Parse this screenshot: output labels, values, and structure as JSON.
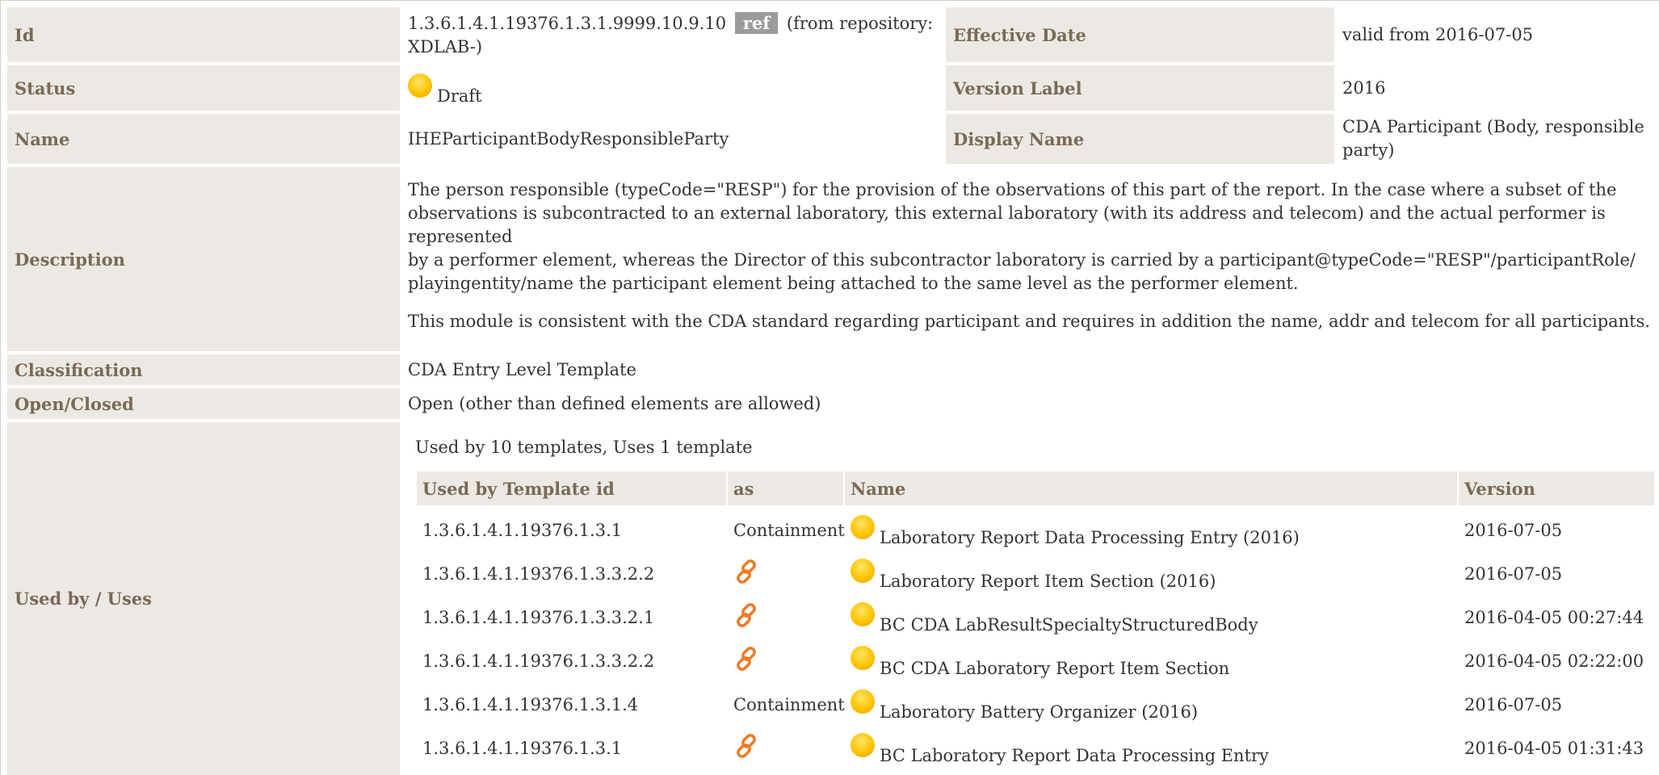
{
  "rows": {
    "id": {
      "label": "Id",
      "value_pre": "1.3.6.1.4.1.19376.1.3.1.9999.10.9.10",
      "ref": "ref",
      "value_post": "(from repository:",
      "value_line2": "XDLAB-)"
    },
    "effective_date": {
      "label": "Effective Date",
      "value": "valid from 2016-07-05"
    },
    "status": {
      "label": "Status",
      "value": "Draft",
      "icon": "status-draft-icon",
      "icon_color": "#ffc400"
    },
    "version_label": {
      "label": "Version Label",
      "value": "2016"
    },
    "name": {
      "label": "Name",
      "value": "IHEParticipantBodyResponsibleParty"
    },
    "display_name": {
      "label": "Display Name",
      "value_line1": "CDA Participant (Body, responsible",
      "value_line2": "party)"
    },
    "description": {
      "label": "Description",
      "para1_line1": "The person responsible (typeCode=\"RESP\") for the provision of the observations of this part of the report. In the case where a subset of the",
      "para1_line2": "observations is subcontracted to an external laboratory, this external laboratory (with its address and telecom) and the actual performer is represented",
      "para1_line3": "by a performer element, whereas the Director of this subcontractor laboratory is carried by a participant@typeCode=\"RESP\"/participantRole/",
      "para1_line4": "playingentity/name the participant element being attached to the same level as the performer element.",
      "para2": "This module is consistent with the CDA standard regarding participant and requires in addition the name, addr and telecom for all participants."
    },
    "classification": {
      "label": "Classification",
      "value": "CDA Entry Level Template"
    },
    "open_closed": {
      "label": "Open/Closed",
      "value": "Open (other than defined elements are allowed)"
    },
    "used_by": {
      "label": "Used by / Uses",
      "summary": "Used by 10 templates, Uses 1 template",
      "headers": {
        "id": "Used by Template id",
        "as": "as",
        "name": "Name",
        "version": "Version"
      },
      "items": [
        {
          "id": "1.3.6.1.4.1.19376.1.3.1",
          "as": "Containment",
          "name": "Laboratory Report Data Processing Entry (2016)",
          "version": "2016-07-05"
        },
        {
          "id": "1.3.6.1.4.1.19376.1.3.3.2.2",
          "as": "link-icon",
          "name": "Laboratory Report Item Section (2016)",
          "version": "2016-07-05"
        },
        {
          "id": "1.3.6.1.4.1.19376.1.3.3.2.1",
          "as": "link-icon",
          "name": "BC CDA LabResultSpecialtyStructuredBody",
          "version": "2016-04-05 00:27:44"
        },
        {
          "id": "1.3.6.1.4.1.19376.1.3.3.2.2",
          "as": "link-icon",
          "name": "BC CDA Laboratory Report Item Section",
          "version": "2016-04-05 02:22:00"
        },
        {
          "id": "1.3.6.1.4.1.19376.1.3.1.4",
          "as": "Containment",
          "name": "Laboratory Battery Organizer (2016)",
          "version": "2016-07-05"
        },
        {
          "id": "1.3.6.1.4.1.19376.1.3.1",
          "as": "link-icon",
          "name": "BC Laboratory Report Data Processing Entry",
          "version": "2016-04-05 01:31:43"
        }
      ],
      "link_color": "#f07a24"
    }
  }
}
